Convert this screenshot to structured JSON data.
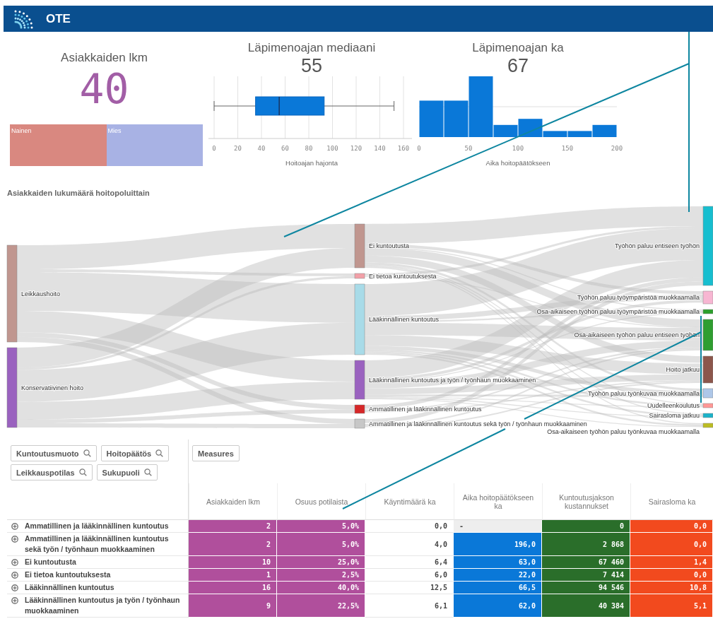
{
  "header": {
    "title": "OTE"
  },
  "kpi": {
    "title": "Asiakkaiden lkm",
    "value": "40"
  },
  "gender": [
    {
      "label": "Nainen",
      "color": "#d98880"
    },
    {
      "label": "Mies",
      "color": "#a8b2e4"
    }
  ],
  "median_panel": {
    "title": "Läpimenoajan mediaani",
    "value": "55",
    "axis": {
      "label": "Hoitoajan hajonta",
      "ticks": [
        "0",
        "20",
        "40",
        "60",
        "80",
        "100",
        "120",
        "140",
        "160"
      ]
    }
  },
  "mean_panel": {
    "title": "Läpimenoajan ka",
    "value": "67",
    "axis": {
      "label": "Aika hoitopäätökseen",
      "ticks": [
        "0",
        "50",
        "100",
        "150",
        "200"
      ]
    }
  },
  "sankey": {
    "title": "Asiakkaiden lukumäärä hoitopoluittain",
    "columns": [
      {
        "nodes": [
          {
            "label": "Leikkaushoito",
            "color": "#c0968f"
          },
          {
            "label": "Konservatiivinen hoito",
            "color": "#9a62bf"
          }
        ]
      },
      {
        "nodes": [
          {
            "label": "Ei kuntoutusta",
            "color": "#c0968f"
          },
          {
            "label": "Ei tietoa kuntoutuksesta",
            "color": "#f2a0a8"
          },
          {
            "label": "Lääkinnällinen kuntoutus",
            "color": "#a8dbe8"
          },
          {
            "label": "Lääkinnällinen kuntoutus ja työn / työnhaun muokkaaminen",
            "color": "#9a62bf"
          },
          {
            "label": "Ammatillinen ja lääkinnällinen kuntoutus",
            "color": "#d62728"
          },
          {
            "label": "Ammatillinen ja lääkinnällinen kuntoutus sekä työn / työnhaun muokkaaminen",
            "color": "#c7c7c7"
          }
        ]
      },
      {
        "nodes": [
          {
            "label": "Työhön paluu entiseen työhön",
            "color": "#17becf"
          },
          {
            "label": "Työhön paluu työympäristöä muokkaamalla",
            "color": "#f7b6d2"
          },
          {
            "label": "Osa-aikaiseen työhön paluu työympäristöä muokkaamalla",
            "color": "#2ca02c"
          },
          {
            "label": "Osa-aikaiseen työhön paluu entiseen työhön",
            "color": "#2f9e30"
          },
          {
            "label": "Hoito jatkuu",
            "color": "#8c564b"
          },
          {
            "label": "Työhön paluu työnkuvaa muokkaamalla",
            "color": "#aec7e8"
          },
          {
            "label": "Uudelleenkoulutus",
            "color": "#ff9896"
          },
          {
            "label": "Sairasloma jatkuu",
            "color": "#1bb3c9"
          },
          {
            "label": "Osa-aikaiseen työhön paluu työnkuvaa muokkaamalla",
            "color": "#bcbd22"
          }
        ]
      }
    ]
  },
  "pivot": {
    "filters": [
      "Kuntoutusmuoto",
      "Hoitopäätös",
      "Leikkauspotilas",
      "Sukupuoli"
    ],
    "measures_button": "Measures",
    "columns": [
      {
        "label": "Asiakkaiden lkm",
        "color": "#b04f9c"
      },
      {
        "label": "Osuus potilaista",
        "color": "#b04f9c"
      },
      {
        "label": "Käyntimäärä ka"
      },
      {
        "label": "Aika hoitopäätökseen ka",
        "color": "#0a78d8"
      },
      {
        "label": "Kuntoutusjakson kustannukset",
        "color": "#2a6e2a"
      },
      {
        "label": "Sairasloma ka",
        "color": "#f24a1e"
      }
    ],
    "rows": [
      {
        "label": "Ammatillinen ja lääkinnällinen kuntoutus",
        "cells": [
          {
            "text": "2"
          },
          {
            "text": "5,0%"
          },
          {
            "text": "0,0"
          },
          {
            "text": "-",
            "empty": true
          },
          {
            "text": "0"
          },
          {
            "text": "0,0"
          }
        ]
      },
      {
        "label": "Ammatillinen ja lääkinnällinen kuntoutus sekä työn / työnhaun muokkaaminen",
        "cells": [
          {
            "text": "2"
          },
          {
            "text": "5,0%"
          },
          {
            "text": "4,0"
          },
          {
            "text": "196,0"
          },
          {
            "text": "2 868"
          },
          {
            "text": "0,0"
          }
        ]
      },
      {
        "label": "Ei kuntoutusta",
        "cells": [
          {
            "text": "10"
          },
          {
            "text": "25,0%"
          },
          {
            "text": "6,4"
          },
          {
            "text": "63,0"
          },
          {
            "text": "67 460"
          },
          {
            "text": "1,4"
          }
        ]
      },
      {
        "label": "Ei tietoa kuntoutuksesta",
        "cells": [
          {
            "text": "1"
          },
          {
            "text": "2,5%"
          },
          {
            "text": "6,0"
          },
          {
            "text": "22,0"
          },
          {
            "text": "7 414"
          },
          {
            "text": "0,0"
          }
        ]
      },
      {
        "label": "Lääkinnällinen kuntoutus",
        "cells": [
          {
            "text": "16"
          },
          {
            "text": "40,0%"
          },
          {
            "text": "12,5"
          },
          {
            "text": "66,5"
          },
          {
            "text": "94 546"
          },
          {
            "text": "10,8"
          }
        ]
      },
      {
        "label": "Lääkinnällinen kuntoutus ja työn / työnhaun muokkaaminen",
        "cells": [
          {
            "text": "9"
          },
          {
            "text": "22,5%"
          },
          {
            "text": "6,1"
          },
          {
            "text": "62,0"
          },
          {
            "text": "40 384"
          },
          {
            "text": "5,1"
          }
        ]
      }
    ]
  }
}
